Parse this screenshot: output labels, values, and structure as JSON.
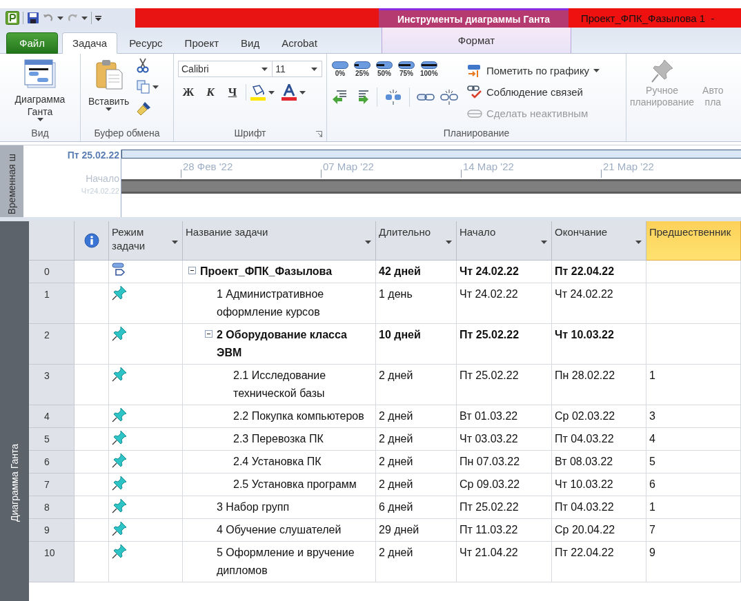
{
  "window": {
    "title": "Проект_ФПК_Фазылова 1  -",
    "context_group": "Инструменты диаграммы Ганта"
  },
  "tabs": [
    {
      "label": "Файл",
      "kind": "file",
      "selected": false
    },
    {
      "label": "Задача",
      "kind": "tab",
      "selected": true
    },
    {
      "label": "Ресурс",
      "kind": "tab",
      "selected": false
    },
    {
      "label": "Проект",
      "kind": "tab",
      "selected": false
    },
    {
      "label": "Вид",
      "kind": "tab",
      "selected": false
    },
    {
      "label": "Acrobat",
      "kind": "tab",
      "selected": false
    },
    {
      "label": "Формат",
      "kind": "context",
      "selected": false
    }
  ],
  "ribbon": {
    "view": {
      "label": "Вид",
      "button": "Диаграмма Ганта"
    },
    "clipboard": {
      "label": "Буфер обмена",
      "paste": "Вставить"
    },
    "font": {
      "label": "Шрифт",
      "font_name": "Calibri",
      "font_size": "11",
      "bold": "Ж",
      "italic": "К",
      "underline": "Ч"
    },
    "schedule": {
      "label": "Планирование",
      "percent_buttons": [
        "0%",
        "25%",
        "50%",
        "75%",
        "100%"
      ],
      "commands": [
        {
          "label": "Пометить по графику",
          "kind": "mark",
          "disabled": false
        },
        {
          "label": "Соблюдение связей",
          "kind": "links",
          "disabled": false
        },
        {
          "label": "Сделать неактивным",
          "kind": "inactive",
          "disabled": true
        }
      ]
    },
    "tasks": [
      {
        "lines": [
          "Ручное",
          "планирование"
        ],
        "disabled": true
      },
      {
        "lines": [
          "Авто",
          "пла"
        ],
        "disabled": true
      }
    ]
  },
  "timeline": {
    "label": "Временная ш",
    "current_date": "Пт 25.02.22",
    "start_label": "Начало",
    "start_date": "Чт24.02.22",
    "ticks": [
      "28 Фев '22",
      "07 Мар '22",
      "14 Мар '22",
      "21 Мар '22"
    ]
  },
  "table": {
    "side_label": "Диаграмма Ганта",
    "columns": [
      {
        "kind": "id",
        "selected": false
      },
      {
        "kind": "info",
        "selected": false
      },
      {
        "kind": "mode",
        "label": "Режим задачи",
        "selected": false
      },
      {
        "kind": "name",
        "label": "Название задачи",
        "selected": false
      },
      {
        "kind": "duration",
        "label": "Длительно",
        "selected": false
      },
      {
        "kind": "start",
        "label": "Начало",
        "selected": false
      },
      {
        "kind": "finish",
        "label": "Окончание",
        "selected": false
      },
      {
        "kind": "predecessors",
        "label": "Предшественник",
        "selected": true
      }
    ],
    "rows": [
      {
        "id": "0",
        "kind": "auto",
        "name": "Проект_ФПК_Фазылова",
        "duration": "42 дней",
        "start": "Чт 24.02.22",
        "finish": "Пт 22.04.22",
        "summary": true,
        "expanded": true,
        "children": [
          {
            "id": "1",
            "kind": "manual",
            "name": "1 Административное оформление курсов",
            "duration": "1 день",
            "start": "Чт 24.02.22",
            "finish": "Чт 24.02.22",
            "summary": false
          },
          {
            "id": "2",
            "kind": "manual",
            "name": "2 Оборудование класса ЭВМ",
            "duration": "10 дней",
            "start": "Пт 25.02.22",
            "finish": "Чт 10.03.22",
            "summary": true,
            "expanded": true,
            "children": [
              {
                "id": "3",
                "kind": "manual",
                "name": "2.1 Исследование технической базы",
                "duration": "2 дней",
                "start": "Пт 25.02.22",
                "finish": "Пн 28.02.22",
                "predecessors": "1",
                "summary": false
              },
              {
                "id": "4",
                "kind": "manual",
                "name": "2.2 Покупка компьютеров",
                "duration": "2 дней",
                "start": "Вт 01.03.22",
                "finish": "Ср 02.03.22",
                "predecessors": "3",
                "summary": false
              },
              {
                "id": "5",
                "kind": "manual",
                "name": "2.3 Перевозка ПК",
                "duration": "2 дней",
                "start": "Чт 03.03.22",
                "finish": "Пт 04.03.22",
                "predecessors": "4",
                "summary": false
              },
              {
                "id": "6",
                "kind": "manual",
                "name": "2.4 Установка ПК",
                "duration": "2 дней",
                "start": "Пн 07.03.22",
                "finish": "Вт 08.03.22",
                "predecessors": "5",
                "summary": false
              },
              {
                "id": "7",
                "kind": "manual",
                "name": "2.5 Установка программ",
                "duration": "2 дней",
                "start": "Ср 09.03.22",
                "finish": "Чт 10.03.22",
                "predecessors": "6",
                "summary": false
              }
            ]
          },
          {
            "id": "8",
            "kind": "manual",
            "name": "3 Набор групп",
            "duration": "6 дней",
            "start": "Пт 25.02.22",
            "finish": "Пт 04.03.22",
            "predecessors": "1",
            "summary": false
          },
          {
            "id": "9",
            "kind": "manual",
            "name": "4 Обучение слушателей",
            "duration": "29 дней",
            "start": "Пт 11.03.22",
            "finish": "Ср 20.04.22",
            "predecessors": "7",
            "summary": false
          },
          {
            "id": "10",
            "kind": "manual",
            "name": "5 Оформление и вручение дипломов",
            "duration": "2 дней",
            "start": "Чт 21.04.22",
            "finish": "Пт 22.04.22",
            "predecessors": "9",
            "summary": false
          }
        ]
      }
    ]
  }
}
